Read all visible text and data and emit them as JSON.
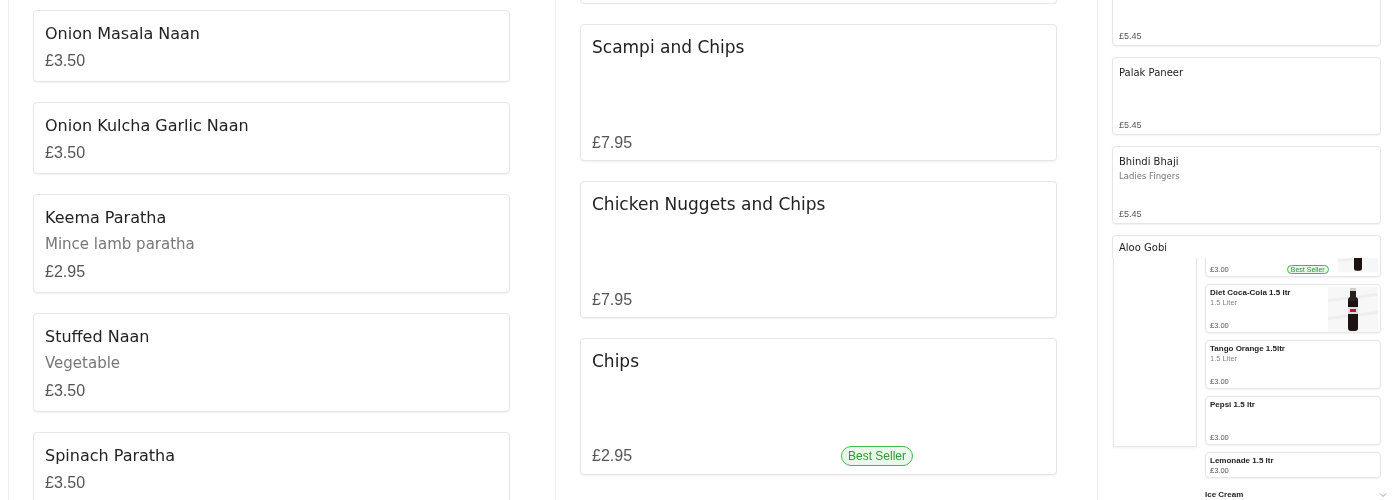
{
  "panels": [
    {
      "kind": "compact",
      "cards": [
        {
          "title": "Onion Masala Naan",
          "price": "£3.50"
        },
        {
          "title": "Onion Kulcha Garlic Naan",
          "price": "£3.50"
        },
        {
          "title": "Keema Paratha",
          "description": "Mince lamb paratha",
          "price": "£2.95"
        },
        {
          "title": "Stuffed Naan",
          "description": "Vegetable",
          "price": "£3.50"
        },
        {
          "title": "Spinach Paratha",
          "price": "£3.50"
        }
      ]
    },
    {
      "kind": "tall",
      "cards": [
        {
          "title": "Scampi and Chips",
          "price": "£7.95"
        },
        {
          "title": "Chicken Nuggets and Chips",
          "price": "£7.95"
        },
        {
          "title": "Chips",
          "price": "£2.95",
          "badge": "Best Seller"
        }
      ]
    },
    {
      "kind": "small",
      "cards": [
        {
          "price": "£5.45"
        },
        {
          "title": "Palak Paneer",
          "price": "£5.45"
        },
        {
          "title": "Bhindi Bhaji",
          "description": "Ladies Fingers",
          "price": "£5.45"
        },
        {
          "title": "Aloo Gobi"
        }
      ]
    }
  ],
  "inset": {
    "cards": [
      {
        "price": "£3.00",
        "badge": "Best Seller"
      },
      {
        "title": "Diet Coca-Cola 1.5 ltr",
        "description": "1.5 Liter",
        "price": "£3.00"
      },
      {
        "title": "Tango Orange 1.5ltr",
        "description": "1.5 Liter",
        "price": "£3.00"
      },
      {
        "title": "Pepsi 1.5 ltr",
        "price": "£3.00"
      },
      {
        "title": "Lemonade 1.5 ltr",
        "price": "£3.00",
        "kind": "short"
      }
    ],
    "section": {
      "title": "Ice Cream",
      "expanded": false
    }
  }
}
